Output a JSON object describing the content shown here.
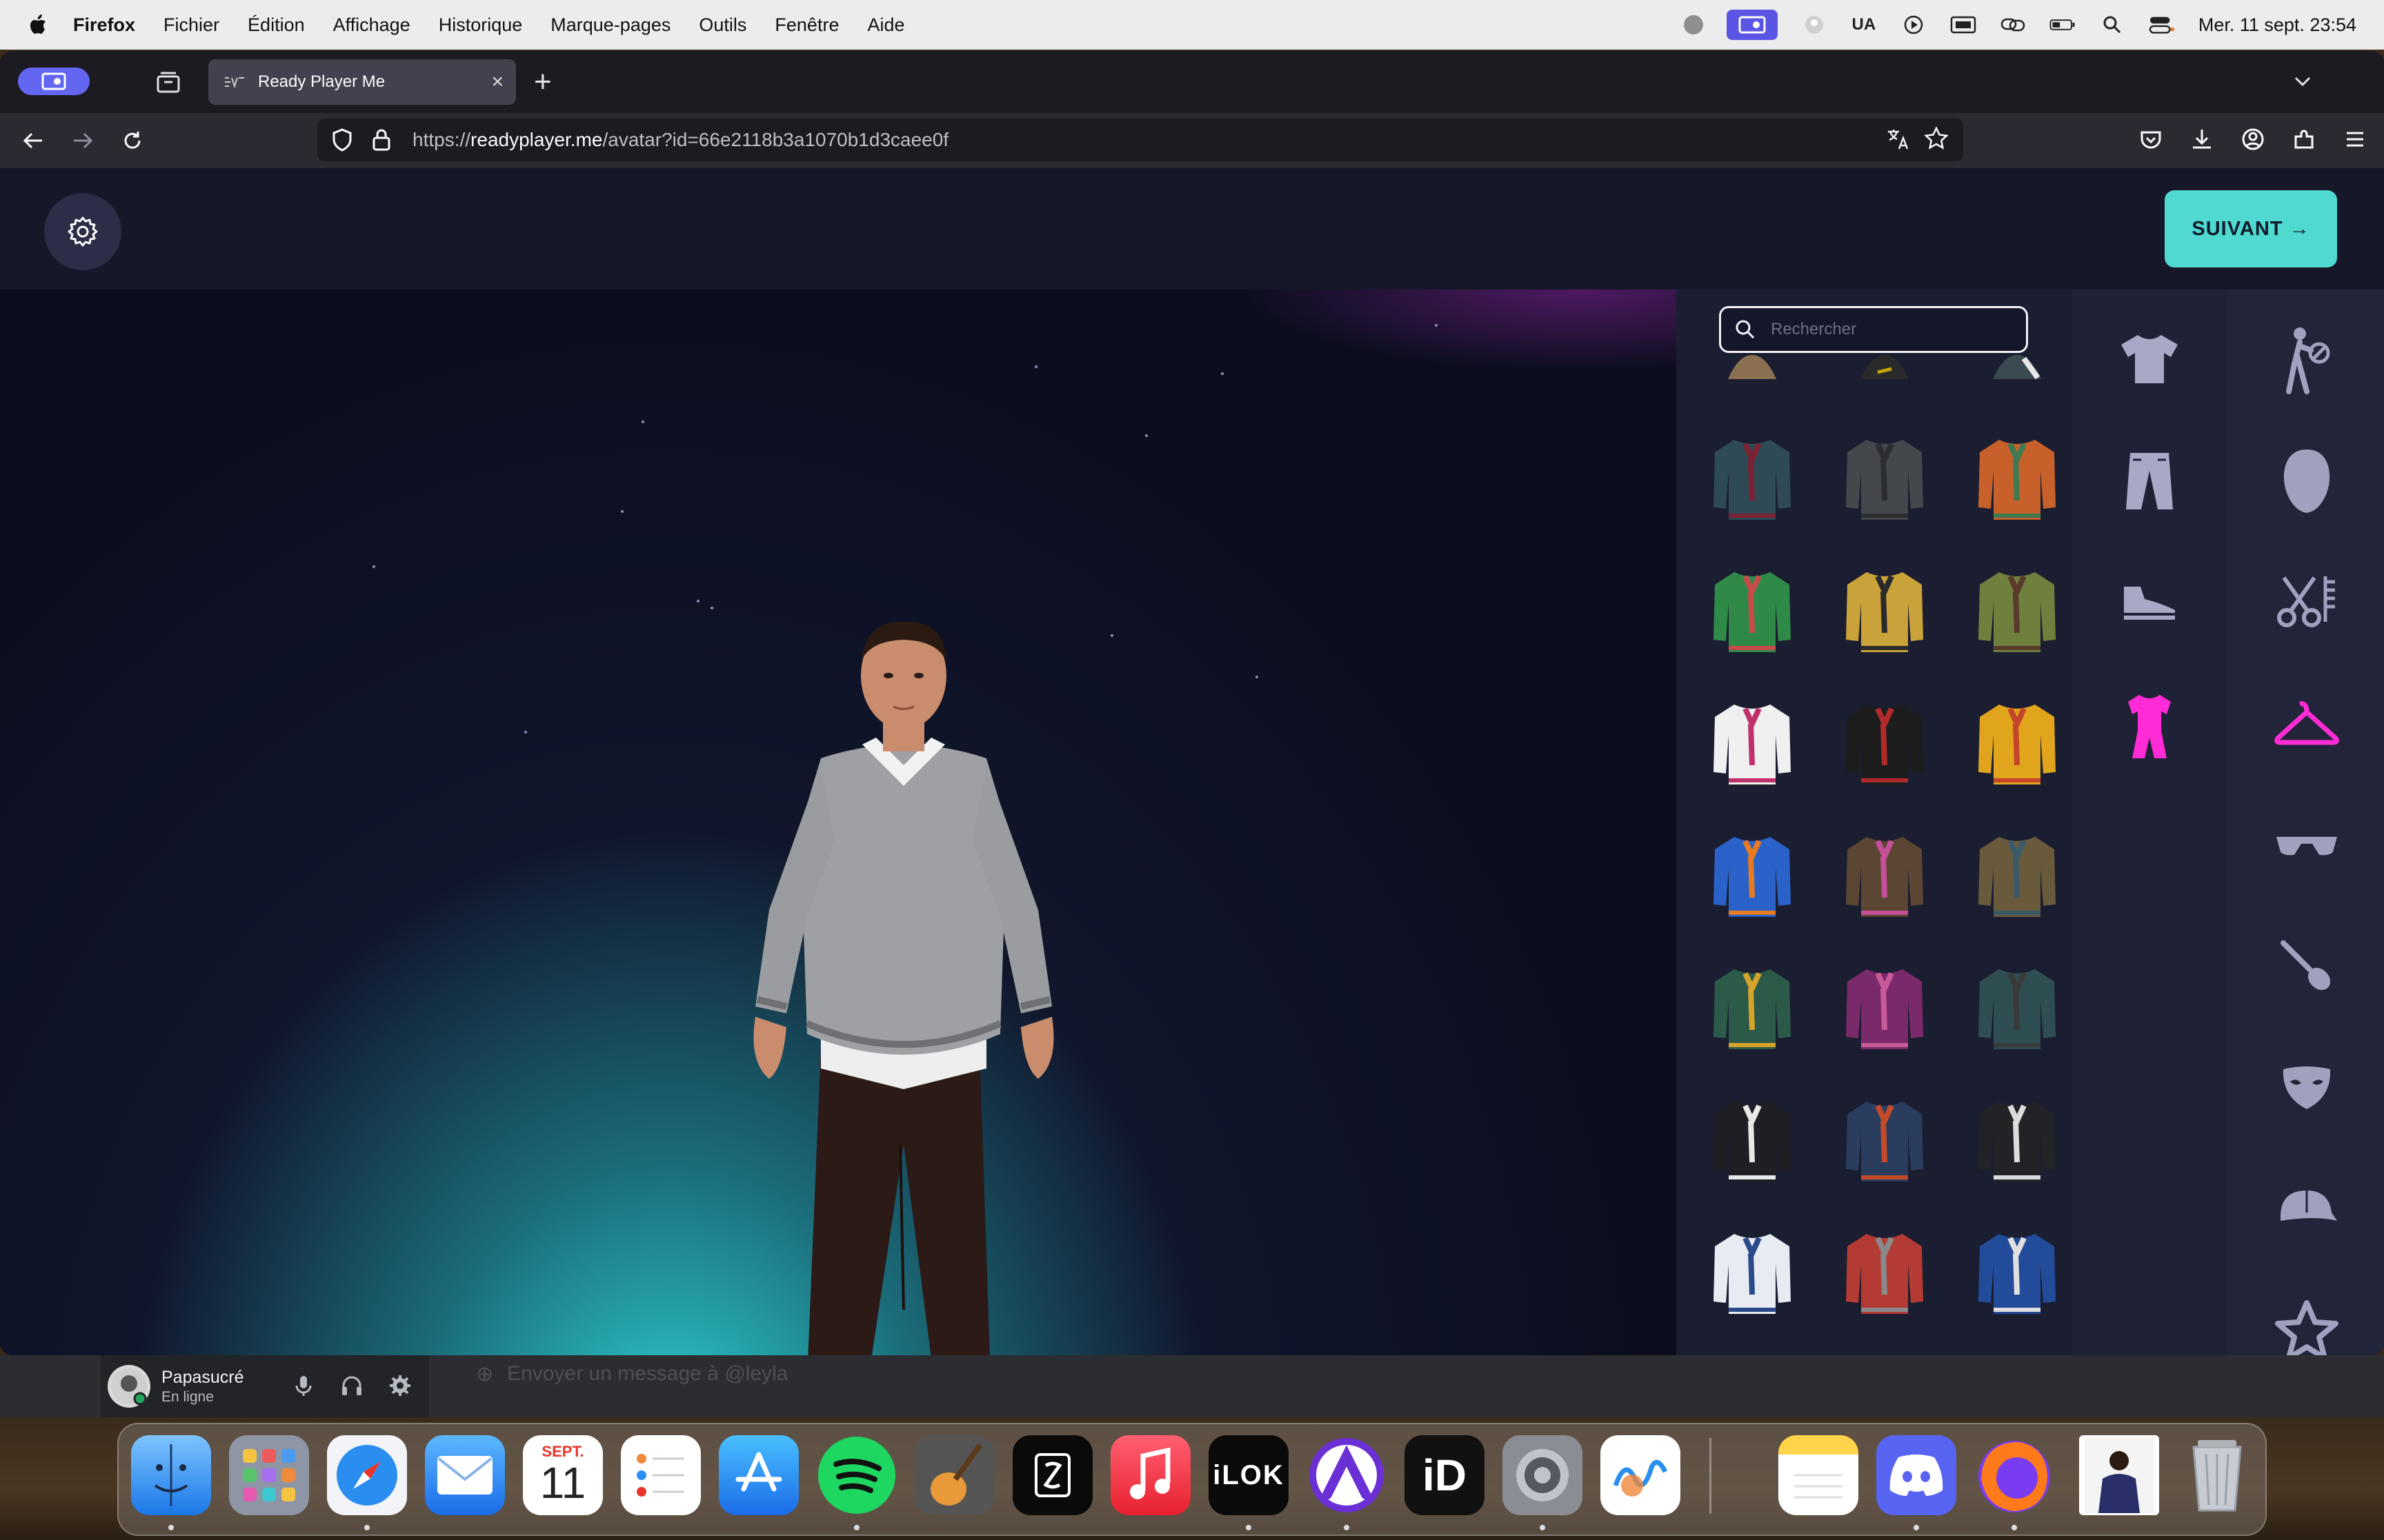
{
  "menubar": {
    "app": "Firefox",
    "items": [
      "Fichier",
      "Édition",
      "Affichage",
      "Historique",
      "Marque-pages",
      "Outils",
      "Fenêtre",
      "Aide"
    ],
    "input_source": "UA",
    "clock": "Mer. 11 sept.  23:54"
  },
  "browser": {
    "tab_title": "Ready Player Me",
    "url_prefix": "https://",
    "url_domain": "readyplayer.me",
    "url_path": "/avatar?id=66e2118b3a1070b1d3caee0f"
  },
  "rpm": {
    "next_button": "SUIVANT →",
    "search_placeholder": "Rechercher",
    "accent_color": "#ff2bd6",
    "button_color": "#4fd9d1",
    "items": [
      {
        "name": "teal-hooded-jacket",
        "color": "#2e4a55",
        "accent": "#7c2233"
      },
      {
        "name": "gray-hoodie",
        "color": "#44484c",
        "accent": "#2b2d30"
      },
      {
        "name": "orange-vest-jacket",
        "color": "#c7602a",
        "accent": "#3f7a52"
      },
      {
        "name": "green-patterned-sweater",
        "color": "#2f8a48",
        "accent": "#c94a4a"
      },
      {
        "name": "yellow-diamond-sweater",
        "color": "#caa23a",
        "accent": "#2a2a2a"
      },
      {
        "name": "olive-sweater",
        "color": "#6f7f3e",
        "accent": "#5a3a2a"
      },
      {
        "name": "white-shirt-red-tie",
        "color": "#f0f0f0",
        "accent": "#c0306a"
      },
      {
        "name": "black-vest-red-tie",
        "color": "#1d1d1d",
        "accent": "#b02a2a"
      },
      {
        "name": "yellow-dress",
        "color": "#e0a51c",
        "accent": "#c4452a"
      },
      {
        "name": "blue-india-jersey",
        "color": "#2a62c9",
        "accent": "#e87a1f"
      },
      {
        "name": "brown-trench-coat",
        "color": "#5a4632",
        "accent": "#c74f9a"
      },
      {
        "name": "khaki-jacket",
        "color": "#6a5a3c",
        "accent": "#3a5a6a"
      },
      {
        "name": "green-armor-suit",
        "color": "#2c5a48",
        "accent": "#d6a42a"
      },
      {
        "name": "pink-feather-top",
        "color": "#7a2a6a",
        "accent": "#c85a9a"
      },
      {
        "name": "dark-teal-sweater",
        "color": "#2f4e52",
        "accent": "#3a3a3a"
      },
      {
        "name": "black-suit-jacket",
        "color": "#1e1f22",
        "accent": "#e8e8e8"
      },
      {
        "name": "denim-jacket",
        "color": "#2a3d5e",
        "accent": "#c44a2a"
      },
      {
        "name": "black-blazer",
        "color": "#222326",
        "accent": "#dcdcdc"
      },
      {
        "name": "white-puffer-jacket",
        "color": "#e8ecf2",
        "accent": "#2a4a8a"
      },
      {
        "name": "red-varsity-jacket",
        "color": "#b43a34",
        "accent": "#8a8a8a"
      },
      {
        "name": "blue-tracksuit",
        "color": "#224c9a",
        "accent": "#e0e0e0"
      }
    ]
  },
  "discord": {
    "username": "Papasucré",
    "status": "En ligne",
    "message_placeholder": "Envoyer un message à @leyla"
  },
  "dock": {
    "calendar_month": "SEPT.",
    "calendar_day": "11",
    "ilok_label": "iLOK",
    "id_label": "iD"
  }
}
